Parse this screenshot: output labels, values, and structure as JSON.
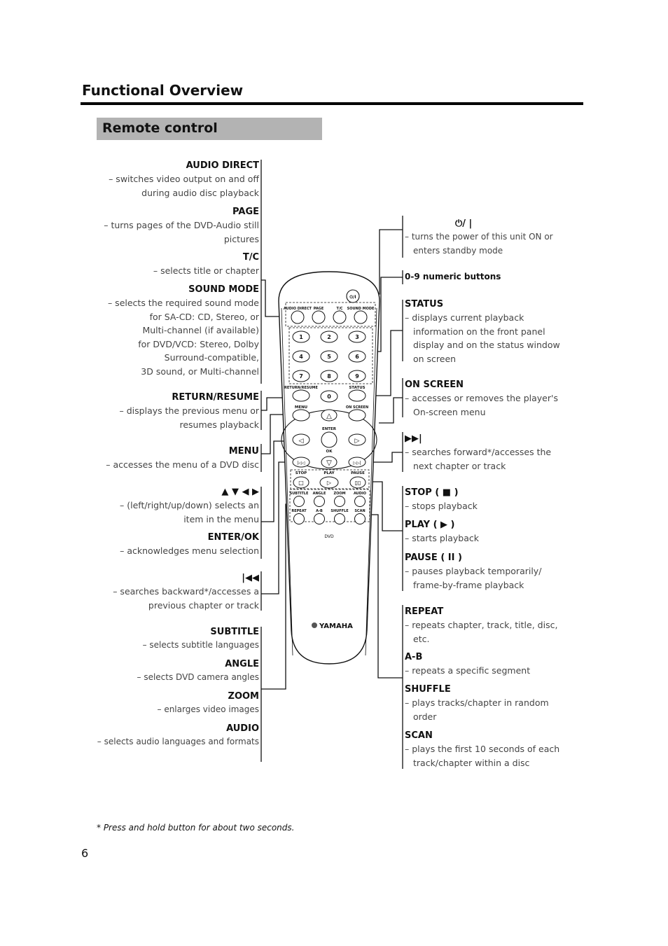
{
  "header": {
    "section_title": "Functional Overview",
    "subsection_title": "Remote control"
  },
  "left_callouts": [
    {
      "title": "AUDIO DIRECT",
      "desc": [
        "– switches video output on and off",
        "during audio disc playback"
      ]
    },
    {
      "title": "PAGE",
      "desc": [
        "– turns pages of the DVD-Audio still",
        "pictures"
      ]
    },
    {
      "title": "T/C",
      "desc": [
        "– selects title or chapter"
      ]
    },
    {
      "title": "SOUND MODE",
      "desc": [
        "– selects the required sound mode",
        "for SA-CD: CD, Stereo, or",
        "Multi-channel (if available)",
        "for DVD/VCD: Stereo, Dolby",
        "Surround-compatible,",
        "3D sound, or Multi-channel"
      ]
    },
    {
      "title": "RETURN/RESUME",
      "desc": [
        "– displays the previous menu or",
        "resumes playback"
      ]
    },
    {
      "title": "MENU",
      "desc": [
        "– accesses the menu of a DVD disc"
      ]
    },
    {
      "title": "▲ ▼ ◀ ▶",
      "desc": [
        "– (left/right/up/down) selects an",
        "item in the menu"
      ]
    },
    {
      "title": "ENTER/OK",
      "desc": [
        "– acknowledges menu selection"
      ]
    },
    {
      "title": "|◀◀",
      "desc": [
        "– searches backward*/accesses a",
        "previous chapter or track"
      ]
    },
    {
      "title": "SUBTITLE",
      "desc": [
        "– selects subtitle languages"
      ]
    },
    {
      "title": "ANGLE",
      "desc": [
        "– selects DVD camera angles"
      ]
    },
    {
      "title": "ZOOM",
      "desc": [
        "– enlarges video images"
      ]
    },
    {
      "title": "AUDIO",
      "desc": [
        "– selects audio languages and formats"
      ]
    }
  ],
  "right_callouts": [
    {
      "title": "⏻/ |",
      "desc": [
        "– turns the power of this unit ON or enters standby mode"
      ]
    },
    {
      "title": "0-9 numeric buttons",
      "desc": []
    },
    {
      "title": "STATUS",
      "desc": [
        "– displays current playback information on the front panel display and on the status window on screen"
      ]
    },
    {
      "title": "ON SCREEN",
      "desc": [
        "– accesses or removes the player's On-screen menu"
      ]
    },
    {
      "title": "▶▶|",
      "desc": [
        "– searches forward*/accesses the next chapter or track"
      ]
    },
    {
      "title": "STOP ( ■ )",
      "desc": [
        "– stops playback"
      ]
    },
    {
      "title": "PLAY ( ▶ )",
      "desc": [
        "– starts playback"
      ]
    },
    {
      "title": "PAUSE ( II )",
      "desc": [
        "– pauses playback temporarily/ frame-by-frame playback"
      ]
    },
    {
      "title": "REPEAT",
      "desc": [
        "– repeats chapter, track, title, disc, etc."
      ]
    },
    {
      "title": "A-B",
      "desc": [
        "– repeats a specific segment"
      ]
    },
    {
      "title": "SHUFFLE",
      "desc": [
        "– plays tracks/chapter in random order"
      ]
    },
    {
      "title": "SCAN",
      "desc": [
        "– plays the first 10 seconds of each track/chapter within a disc"
      ]
    }
  ],
  "remote": {
    "top_labels": [
      "AUDIO DIRECT",
      "PAGE",
      "T/C",
      "SOUND MODE"
    ],
    "power_label": "⏻/I",
    "digits": [
      "1",
      "2",
      "3",
      "4",
      "5",
      "6",
      "7",
      "8",
      "9",
      "0"
    ],
    "return_label": "RETURN/RESUME",
    "status_label": "STATUS",
    "menu_label": "MENU",
    "onscreen_label": "ON SCREEN",
    "enter_label": "ENTER",
    "ok_label": "OK",
    "transport_labels": [
      "STOP",
      "PLAY",
      "PAUSE"
    ],
    "row_a_labels": [
      "SUBTITLE",
      "ANGLE",
      "ZOOM",
      "AUDIO"
    ],
    "row_b_labels": [
      "REPEAT",
      "A-B",
      "SHUFFLE",
      "SCAN"
    ],
    "dvd_label": "DVD",
    "brand": "YAMAHA"
  },
  "footnote": "* Press and hold button for about two seconds.",
  "page_number": "6"
}
